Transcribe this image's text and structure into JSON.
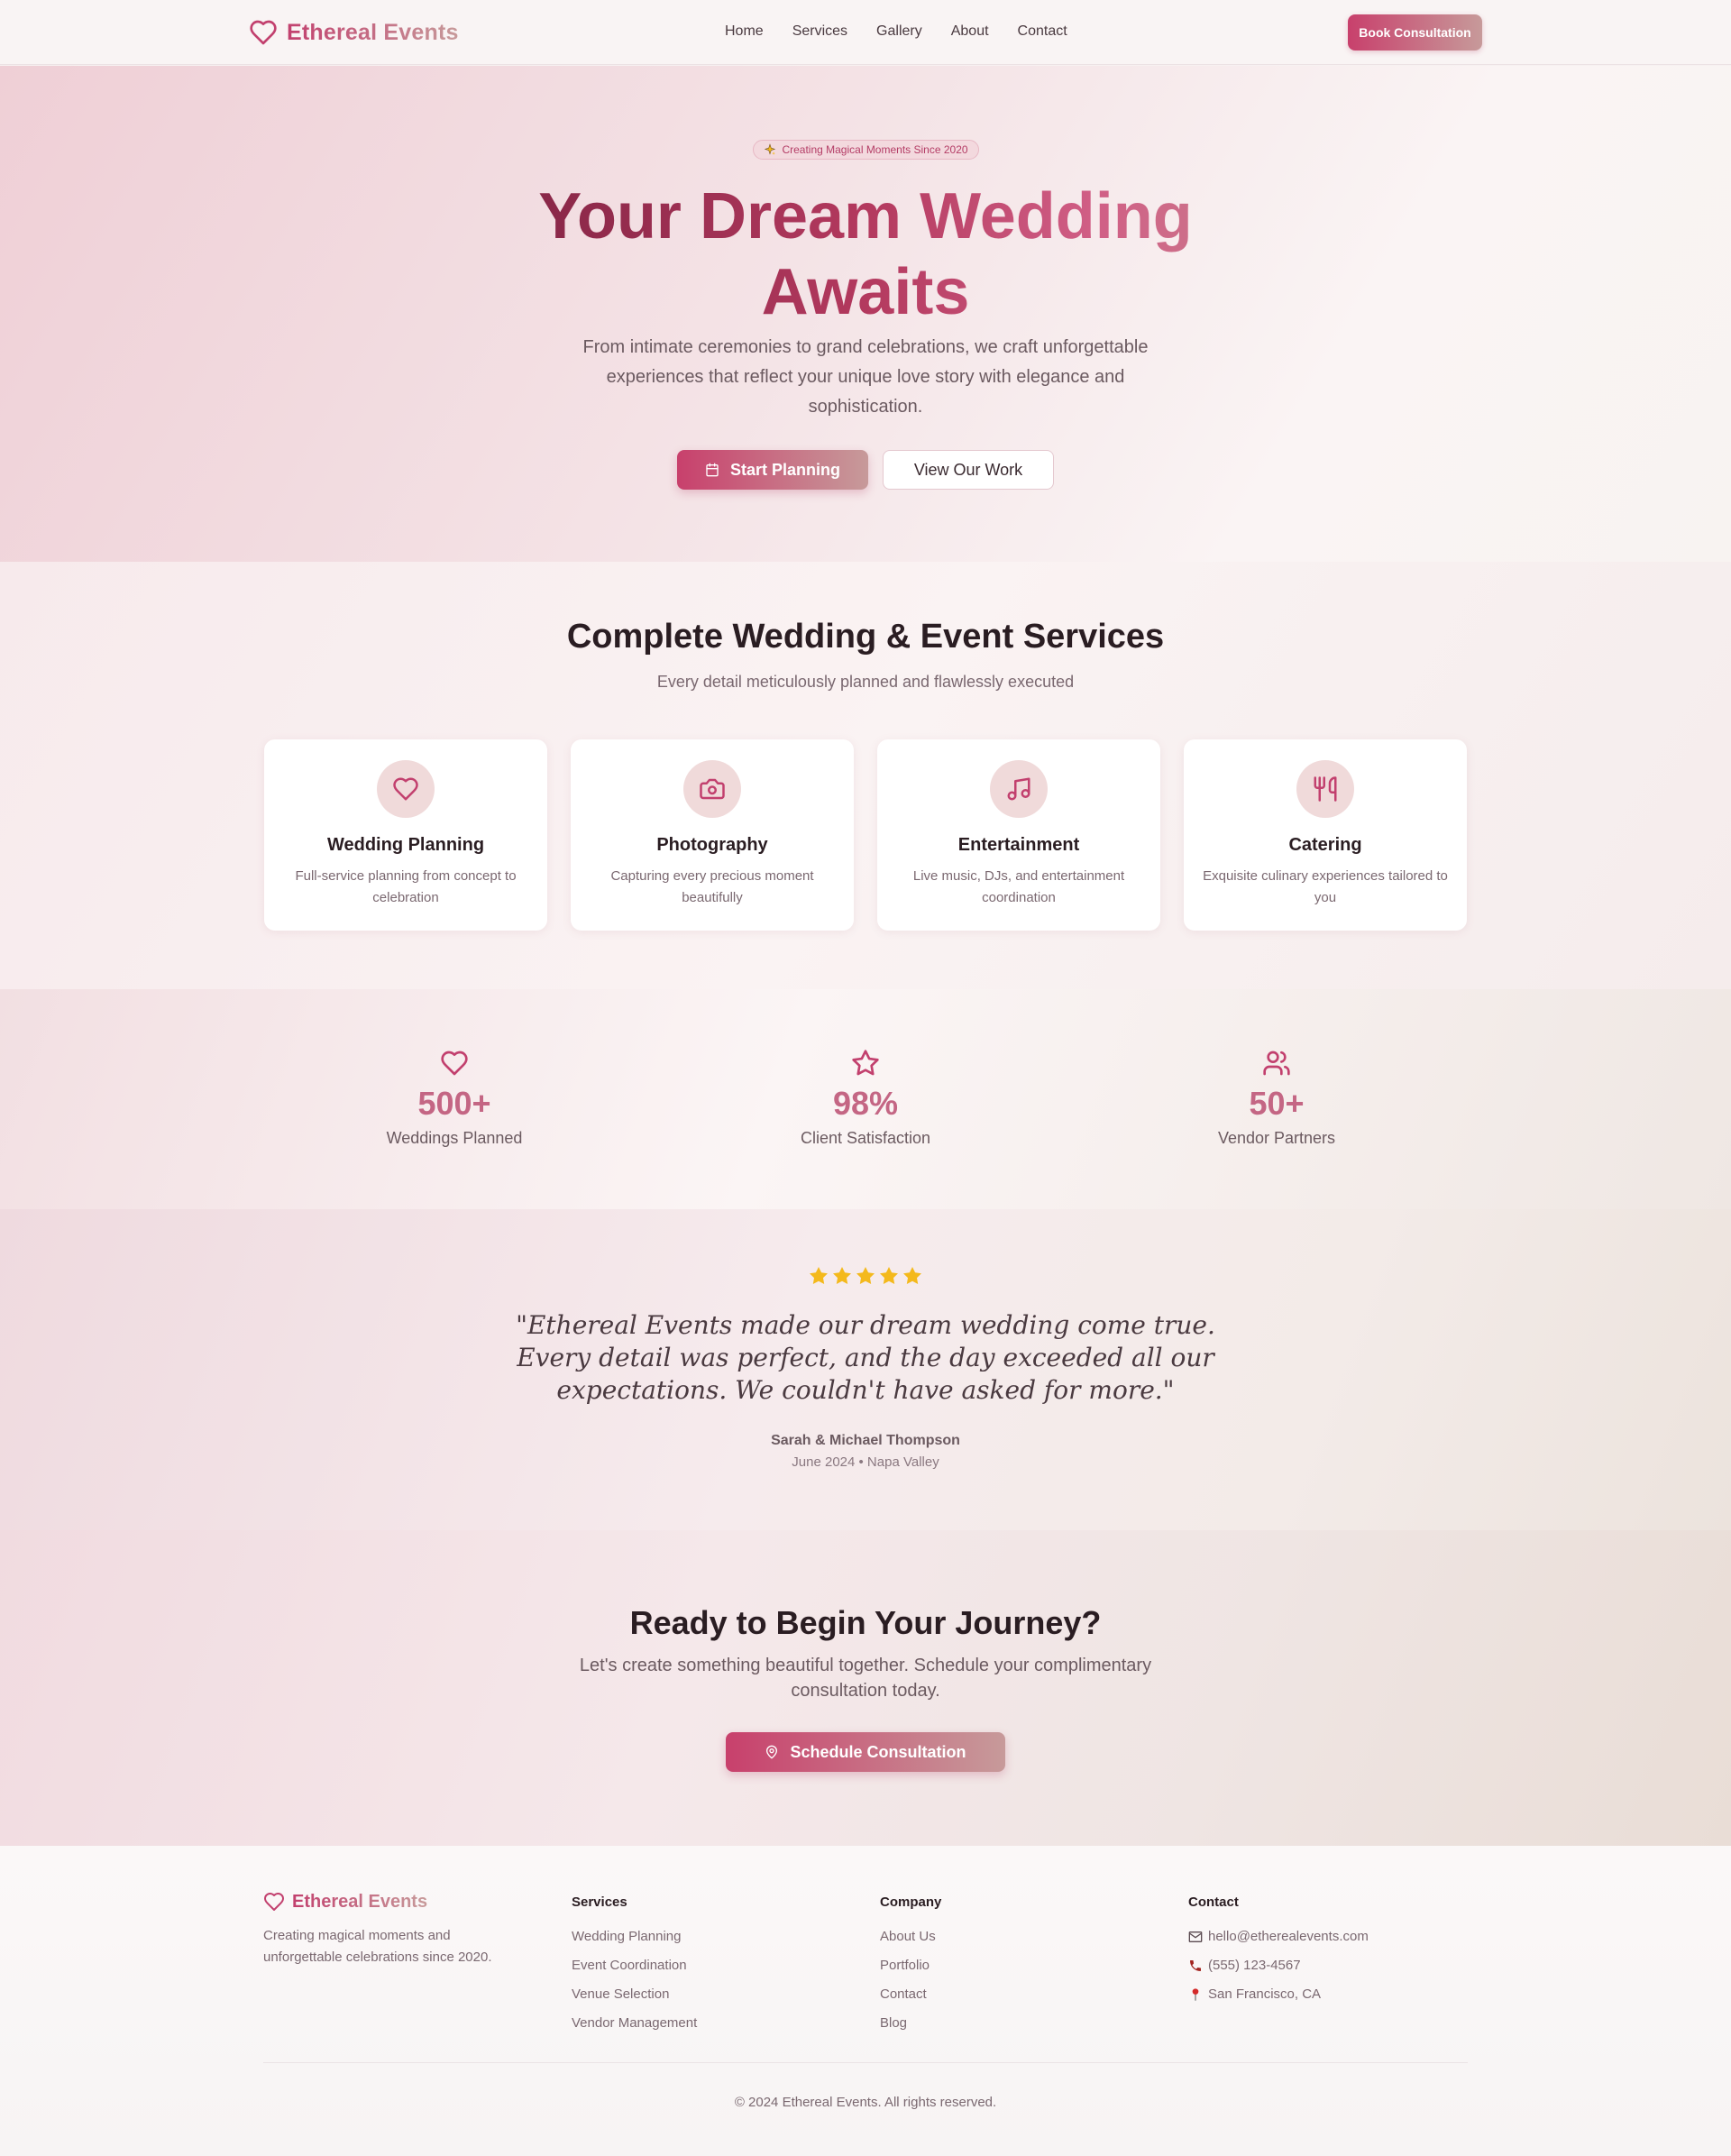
{
  "colors": {
    "brand": "#c2406e",
    "brand_gradient_end": "#c79a9a",
    "star": "#f4b91c",
    "text_dark": "#2a1d22",
    "text_muted": "#7a6870"
  },
  "nav": {
    "brand": "Ethereal Events",
    "brand_icon": "heart-icon",
    "links": [
      "Home",
      "Services",
      "Gallery",
      "About",
      "Contact"
    ],
    "cta": "Book Consultation"
  },
  "hero": {
    "badge_icon": "sparkle-icon",
    "badge": "Creating Magical Moments Since 2020",
    "title_line1": "Your Dream Wedding",
    "title_line2": "Awaits",
    "subtitle": "From intimate ceremonies to grand celebrations, we craft unforgettable experiences that reflect your unique love story with elegance and sophistication.",
    "primary_button": "Start Planning",
    "primary_button_icon": "calendar-icon",
    "secondary_button": "View Our Work"
  },
  "services": {
    "title": "Complete Wedding & Event Services",
    "subtitle": "Every detail meticulously planned and flawlessly executed",
    "cards": [
      {
        "icon": "heart-icon",
        "title": "Wedding Planning",
        "description": "Full-service planning from concept to celebration"
      },
      {
        "icon": "camera-icon",
        "title": "Photography",
        "description": "Capturing every precious moment beautifully"
      },
      {
        "icon": "music-icon",
        "title": "Entertainment",
        "description": "Live music, DJs, and entertainment coordination"
      },
      {
        "icon": "utensils-icon",
        "title": "Catering",
        "description": "Exquisite culinary experiences tailored to you"
      }
    ]
  },
  "stats": [
    {
      "icon": "heart-icon",
      "value": "500+",
      "label": "Weddings Planned"
    },
    {
      "icon": "star-icon",
      "value": "98%",
      "label": "Client Satisfaction"
    },
    {
      "icon": "users-icon",
      "value": "50+",
      "label": "Vendor Partners"
    }
  ],
  "testimonial": {
    "rating": 5,
    "quote": "\"Ethereal Events made our dream wedding come true. Every detail was perfect, and the day exceeded all our expectations. We couldn't have asked for more.\"",
    "author": "Sarah & Michael Thompson",
    "meta": "June 2024 • Napa Valley"
  },
  "cta": {
    "title": "Ready to Begin Your Journey?",
    "subtitle": "Let's create something beautiful together. Schedule your complimentary consultation today.",
    "button": "Schedule Consultation",
    "button_icon": "map-pin-icon"
  },
  "footer": {
    "brand": "Ethereal Events",
    "description": "Creating magical moments and unforgettable celebrations since 2020.",
    "columns": [
      {
        "heading": "Services",
        "items": [
          "Wedding Planning",
          "Event Coordination",
          "Venue Selection",
          "Vendor Management"
        ]
      },
      {
        "heading": "Company",
        "items": [
          "About Us",
          "Portfolio",
          "Contact",
          "Blog"
        ]
      }
    ],
    "contact": {
      "heading": "Contact",
      "email": "hello@etherealevents.com",
      "phone": "(555) 123-4567",
      "location": "San Francisco, CA"
    },
    "copyright": "© 2024 Ethereal Events. All rights reserved."
  }
}
